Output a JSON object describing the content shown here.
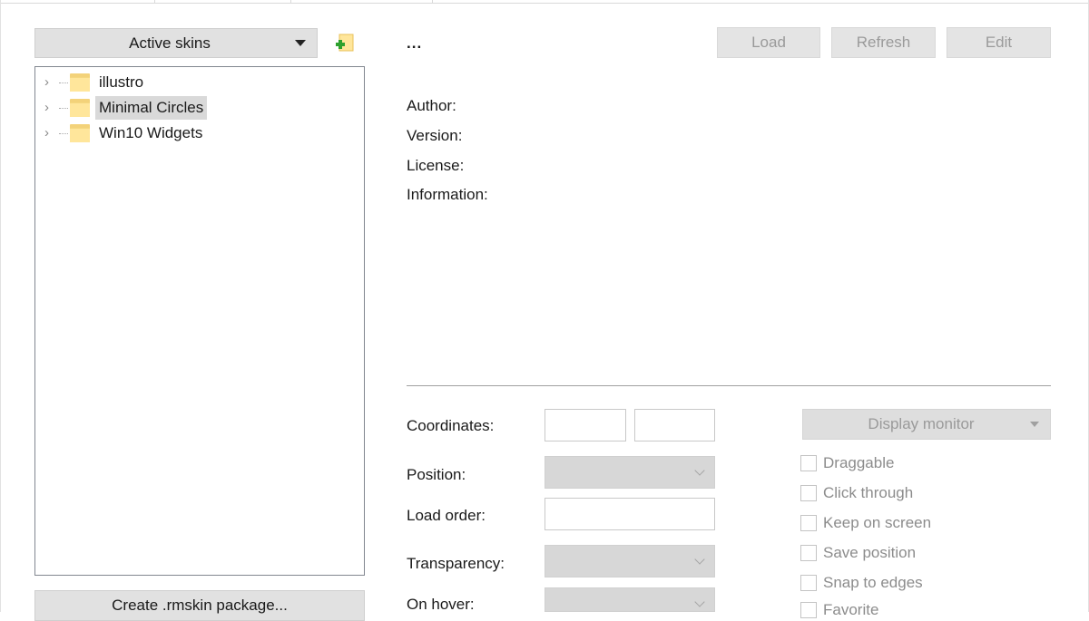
{
  "skins_panel": {
    "dropdown_label": "Active skins",
    "tree": [
      {
        "label": "illustro",
        "selected": false
      },
      {
        "label": "Minimal Circles",
        "selected": true
      },
      {
        "label": "Win10 Widgets",
        "selected": false
      }
    ],
    "create_package_label": "Create .rmskin package..."
  },
  "details": {
    "title": "...",
    "buttons": {
      "load": "Load",
      "refresh": "Refresh",
      "edit": "Edit"
    },
    "author_label": "Author:",
    "version_label": "Version:",
    "license_label": "License:",
    "information_label": "Information:"
  },
  "settings": {
    "coordinates_label": "Coordinates:",
    "position_label": "Position:",
    "load_order_label": "Load order:",
    "transparency_label": "Transparency:",
    "on_hover_label": "On hover:",
    "display_monitor_label": "Display monitor",
    "checkboxes": [
      {
        "label": "Draggable"
      },
      {
        "label": "Click through"
      },
      {
        "label": "Keep on screen"
      },
      {
        "label": "Save position"
      },
      {
        "label": "Snap to edges"
      },
      {
        "label": "Favorite"
      }
    ]
  },
  "colors": {
    "button_bg": "#e1e1e1",
    "disabled_text": "#9a9a9a",
    "selection_bg": "#d9d9d9",
    "folder": "#ffe69b"
  }
}
